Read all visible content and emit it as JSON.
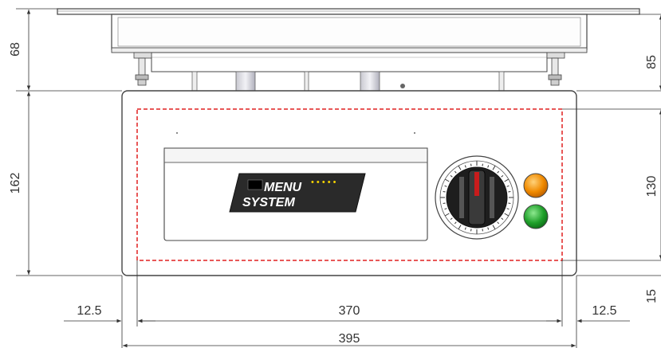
{
  "dimensions": {
    "top_mount_height": "68",
    "body_height": "162",
    "right_top_height": "85",
    "panel_height": "130",
    "bottom_offset": "15",
    "left_margin": "12.5",
    "right_margin": "12.5",
    "inner_width": "370",
    "overall_width": "395"
  },
  "panel": {
    "logo_line1": "MENU",
    "logo_line2": "SYSTEM",
    "logo_dots": "• • • • •"
  },
  "colors": {
    "outline": "#444444",
    "dashed_boundary": "#e02020",
    "indicator_orange": "#f08a00",
    "indicator_green": "#1fa02a",
    "logo_plate": "#2a2a2a"
  },
  "icons": {
    "thermostat_knob": "dial-knob-icon",
    "orange_lamp": "orange-indicator-icon",
    "green_lamp": "green-indicator-icon"
  }
}
